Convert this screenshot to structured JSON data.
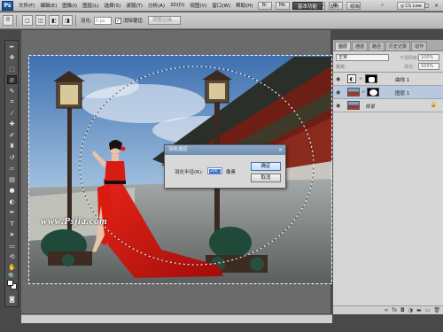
{
  "menubar": {
    "logo": "Ps",
    "items": [
      "文件(F)",
      "编辑(E)",
      "图像(I)",
      "图层(L)",
      "选择(S)",
      "滤镜(T)",
      "分析(A)",
      "3D(D)",
      "视图(V)",
      "窗口(W)",
      "帮助(H)"
    ],
    "zoom": "100%",
    "workspace_active": "基本功能",
    "workspace_links": [
      "设计",
      "绘画"
    ],
    "cslive": "CS Live"
  },
  "options": {
    "feather_label": "羽化:",
    "feather_value": "0 px",
    "antialias_label": "消除锯齿",
    "refine_button": "调整边缘..."
  },
  "document": {
    "watermark": "www.Psjia.com"
  },
  "dialog": {
    "title": "羽化选区",
    "radius_label": "羽化半径(R):",
    "radius_value": "200",
    "unit": "像素",
    "ok_label": "确定",
    "cancel_label": "取消"
  },
  "panel": {
    "tabs": [
      "图层",
      "通道",
      "路径",
      "历史记录",
      "动作"
    ],
    "blend_mode": "正常",
    "opacity_label": "不透明度:",
    "opacity_value": "100%",
    "lock_label": "锁定:",
    "fill_label": "填充:",
    "fill_value": "100%",
    "layers": [
      {
        "name": "曲线 1",
        "kind": "adjustment"
      },
      {
        "name": "图层 1",
        "kind": "pixel"
      },
      {
        "name": "背景",
        "kind": "background"
      }
    ]
  }
}
